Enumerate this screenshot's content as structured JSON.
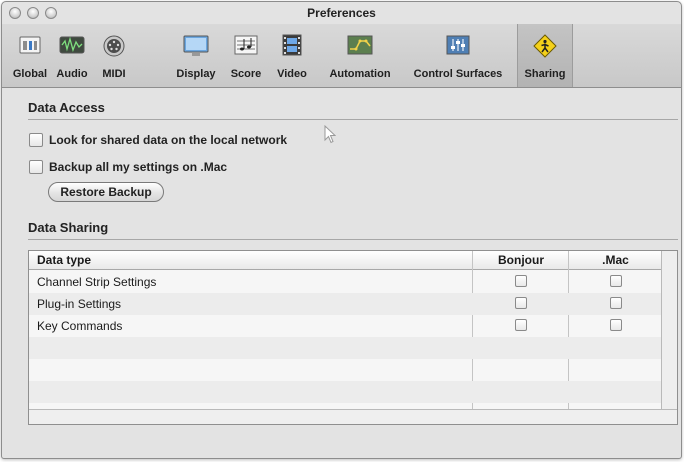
{
  "window": {
    "title": "Preferences"
  },
  "toolbar": {
    "items": [
      {
        "label": "Global",
        "icon": "global-icon"
      },
      {
        "label": "Audio",
        "icon": "audio-icon"
      },
      {
        "label": "MIDI",
        "icon": "midi-icon"
      },
      {
        "label": "Display",
        "icon": "display-icon"
      },
      {
        "label": "Score",
        "icon": "score-icon"
      },
      {
        "label": "Video",
        "icon": "video-icon"
      },
      {
        "label": "Automation",
        "icon": "automation-icon"
      },
      {
        "label": "Control Surfaces",
        "icon": "control-surfaces-icon"
      },
      {
        "label": "Sharing",
        "icon": "sharing-icon",
        "selected": true
      }
    ]
  },
  "data_access": {
    "title": "Data Access",
    "look_shared_label": "Look for shared data on the local network",
    "look_shared_checked": false,
    "backup_label": "Backup all my settings on .Mac",
    "backup_checked": false,
    "restore_label": "Restore Backup"
  },
  "data_sharing": {
    "title": "Data Sharing",
    "columns": [
      "Data type",
      "Bonjour",
      ".Mac"
    ],
    "rows": [
      {
        "name": "Channel Strip Settings",
        "bonjour": false,
        "mac": false
      },
      {
        "name": "Plug-in Settings",
        "bonjour": false,
        "mac": false
      },
      {
        "name": "Key Commands",
        "bonjour": false,
        "mac": false
      }
    ]
  },
  "colors": {
    "window_bg": "#e3e3e3",
    "toolbar_bg": "#d0d0d0",
    "selected_tab": "#b8b8b8"
  }
}
